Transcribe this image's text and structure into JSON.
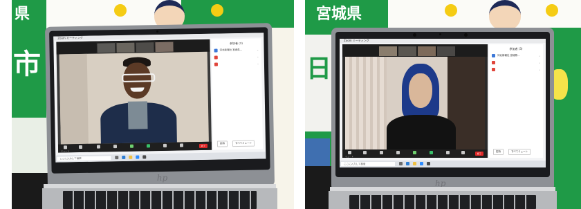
{
  "photo_left": {
    "banner_text": "県",
    "banner_big_char": "市",
    "zoom_window_title": "Zoom ミーティング",
    "participants_header": "参加者 (3)",
    "participant_names": [
      "河北新報社 宮城県…",
      "",
      ""
    ],
    "toolbar_items": [
      "ミュート",
      "ビデオの停止",
      "セキュリティ",
      "参加者",
      "チャット",
      "画面の共有",
      "レコーディング",
      "リアクション"
    ],
    "end_label": "終了",
    "panel_buttons": [
      "招待",
      "すべてミュート"
    ],
    "taskbar_search": "ここに入力して検索",
    "hp_logo": "hp"
  },
  "photo_right": {
    "banner_text": "宮城県",
    "banner_big_char": "日",
    "zoom_window_title": "Zoom ミーティング",
    "participants_header": "参加者 (3)",
    "participant_names": [
      "河北新報社 宮城県…",
      "",
      ""
    ],
    "toolbar_items": [
      "ミュート",
      "ビデオの停止",
      "セキュリティ",
      "参加者",
      "チャット",
      "画面の共有",
      "レコーディング",
      "リアクション"
    ],
    "end_label": "終了",
    "panel_buttons": [
      "招待",
      "すべてミュート"
    ],
    "taskbar_search": "ここに入力して検索",
    "hp_logo": "hp"
  },
  "colors": {
    "banner_green": "#1f9a47",
    "end_red": "#e02828",
    "zoom_dark": "#1f1f1f",
    "laptop_silver": "#8d9095"
  }
}
